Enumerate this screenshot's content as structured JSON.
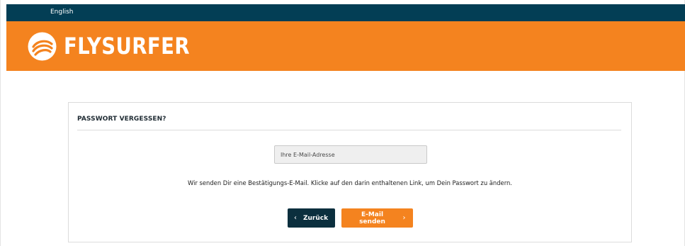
{
  "topbar": {
    "language_link": "English",
    "background": "#033e55"
  },
  "header": {
    "logo_text": "FLYSURFER",
    "logo_icon": "flysurfer-kite-logo-icon",
    "background": "#f4831f"
  },
  "form": {
    "title": "PASSWORT VERGESSEN?",
    "email_placeholder": "Ihre E-Mail-Adresse",
    "email_value": "",
    "info_text": "Wir senden Dir eine Bestätigungs-E-Mail. Klicke auf den darin enthaltenen Link, um Dein Passwort zu ändern.",
    "back_button": {
      "label": "Zurück",
      "icon": "chevron-left-icon",
      "color": "#0b2f3e"
    },
    "send_button": {
      "label": "E-Mail senden",
      "icon": "chevron-right-icon",
      "color": "#f4831f"
    }
  }
}
